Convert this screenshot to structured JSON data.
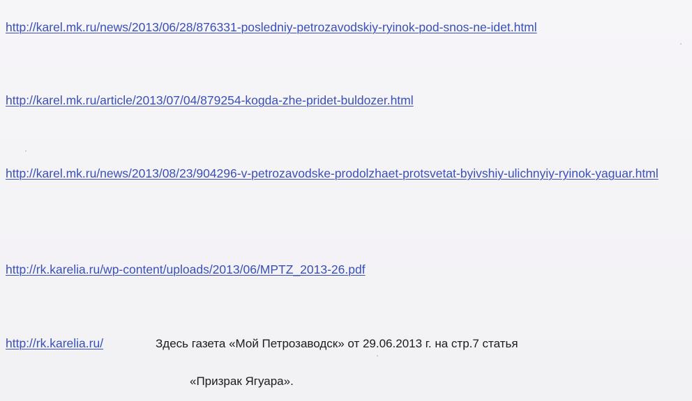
{
  "links": [
    "http://karel.mk.ru/news/2013/06/28/876331-posledniy-petrozavodskiy-ryinok-pod-snos-ne-idet.html",
    "http://karel.mk.ru/article/2013/07/04/879254-kogda-zhe-pridet-buldozer.html",
    "http://karel.mk.ru/news/2013/08/23/904296-v-petrozavodske-prodolzhaet-protsvetat-byivshiy-ulichnyiy-ryinok-yaguar.html",
    "http://rk.karelia.ru/wp-content/uploads/2013/06/MPTZ_2013-26.pdf",
    "http://rk.karelia.ru/"
  ],
  "note": {
    "line1": "Здесь газета «Мой Петрозаводск» от 29.06.2013 г. на стр.7 статья",
    "line2": "«Призрак Ягуара»."
  }
}
